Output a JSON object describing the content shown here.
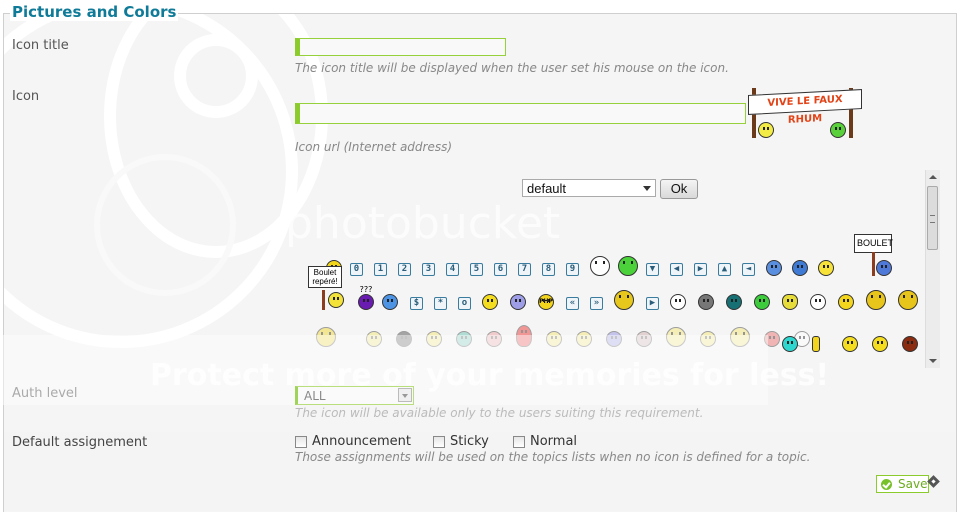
{
  "section": {
    "title": "Pictures and Colors"
  },
  "icon_title": {
    "label": "Icon title",
    "value": "",
    "hint": "The icon title will be displayed when the user set his mouse on the icon."
  },
  "icon": {
    "label": "Icon",
    "value": "",
    "hint": "Icon url (Internet address)",
    "preview_text": "VIVE LE FAUX RHUM"
  },
  "picker": {
    "album_select": "default",
    "ok_label": "Ok",
    "row1": [
      "@",
      "0",
      "1",
      "2",
      "3",
      "4",
      "5",
      "6",
      "7",
      "8",
      "9",
      "shocked",
      "alien",
      "down",
      "left",
      "right",
      "up",
      "back",
      "grin-blue",
      "grin-blue-2",
      "bomb",
      "BOULET"
    ],
    "row2": [
      "Boulet repéré!",
      "???",
      "cool",
      "$",
      "*",
      "o",
      "bubbles",
      "geek",
      "PHP",
      "rewind",
      "forward",
      "bandit",
      "play",
      "eyes",
      "grin-grey",
      "teal",
      "grin-green",
      "heart",
      "bunny",
      "arrow-right",
      "arrow-down",
      "arrow-left"
    ],
    "row3": [
      "arrow-up",
      "kick",
      "batman",
      "smile",
      "teeth-teal",
      "teeth-pink",
      "gnome",
      "eye",
      "hmm",
      "smurf",
      "cat",
      "cheer",
      "tongue",
      "big-grin",
      "cherry",
      "rabbit",
      "cyan",
      "pill",
      "neutral",
      "shades",
      "brown"
    ],
    "sign_boulet": "BOULET",
    "sign_repere_1": "Boulet",
    "sign_repere_2": "repéré!",
    "question_marks": "???",
    "php": "PHP"
  },
  "watermark": {
    "top": "photobucket",
    "bottom": "Protect more of your memories for less!"
  },
  "auth": {
    "label": "Auth level",
    "value": "ALL",
    "hint": "The icon will be available only to the users suiting this requirement."
  },
  "assignment": {
    "label": "Default assignement",
    "options": [
      {
        "label": "Announcement",
        "checked": false
      },
      {
        "label": "Sticky",
        "checked": false
      },
      {
        "label": "Normal",
        "checked": false
      }
    ],
    "hint": "Those assignments will be used on the topics lists when no icon is defined for a topic."
  },
  "save_label": "Save",
  "colors": {
    "accent": "#0f7b98",
    "input_border": "#8bcb2c"
  }
}
